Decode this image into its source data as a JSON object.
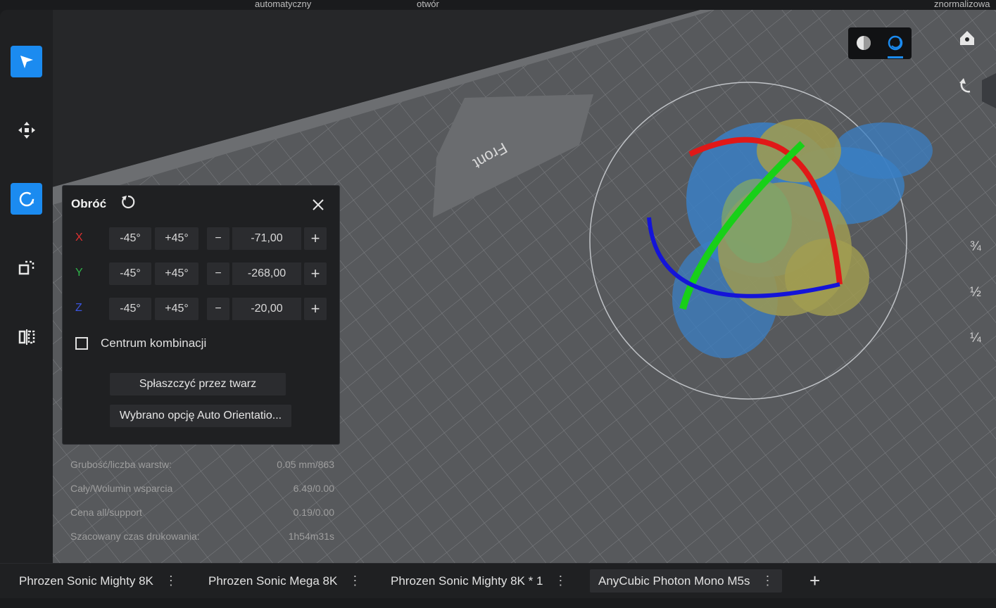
{
  "top_labels": [
    "automatyczny",
    "otwór",
    "znormalizowa"
  ],
  "bed": {
    "front_label": "Front"
  },
  "view_fractions": [
    "¾",
    "½",
    "¼"
  ],
  "rotate_panel": {
    "title": "Obróć",
    "axes": [
      {
        "label": "X",
        "color": "#e03030",
        "minus": "-45°",
        "plus": "+45°",
        "value": "-71,00"
      },
      {
        "label": "Y",
        "color": "#2fb34a",
        "minus": "-45°",
        "plus": "+45°",
        "value": "-268,00"
      },
      {
        "label": "Z",
        "color": "#3a55e0",
        "minus": "-45°",
        "plus": "+45°",
        "value": "-20,00"
      }
    ],
    "decrement": "−",
    "increment": "+",
    "checkbox_label": "Centrum kombinacji",
    "flatten_button": "Spłaszczyć przez twarz",
    "auto_orient_button": "Wybrano opcję Auto Orientatio..."
  },
  "stats": [
    {
      "label": "Grubość/liczba warstw:",
      "value": "0.05 mm/863"
    },
    {
      "label": "Cały/Wolumin wsparcia",
      "value": "6.49/0.00"
    },
    {
      "label": "Cena all/support",
      "value": "0.19/0.00"
    },
    {
      "label": "Szacowany czas drukowania:",
      "value": "1h54m31s"
    }
  ],
  "tabs": [
    {
      "label": "Phrozen Sonic Mighty 8K",
      "active": false
    },
    {
      "label": "Phrozen Sonic Mega 8K",
      "active": false
    },
    {
      "label": "Phrozen Sonic Mighty 8K * 1",
      "active": false
    },
    {
      "label": "AnyCubic Photon Mono M5s",
      "active": true
    }
  ],
  "tab_menu_glyph": "⋮",
  "add_tab_glyph": "+",
  "colors": {
    "accent": "#1b8bf0",
    "x_axis": "#e01818",
    "y_axis": "#18d018",
    "z_axis": "#1414d8"
  },
  "icons": [
    "select-icon",
    "move-icon",
    "rotate-icon",
    "scale-icon",
    "mirror-icon",
    "home-icon",
    "undo-icon",
    "solid-view-icon",
    "xray-view-icon"
  ]
}
